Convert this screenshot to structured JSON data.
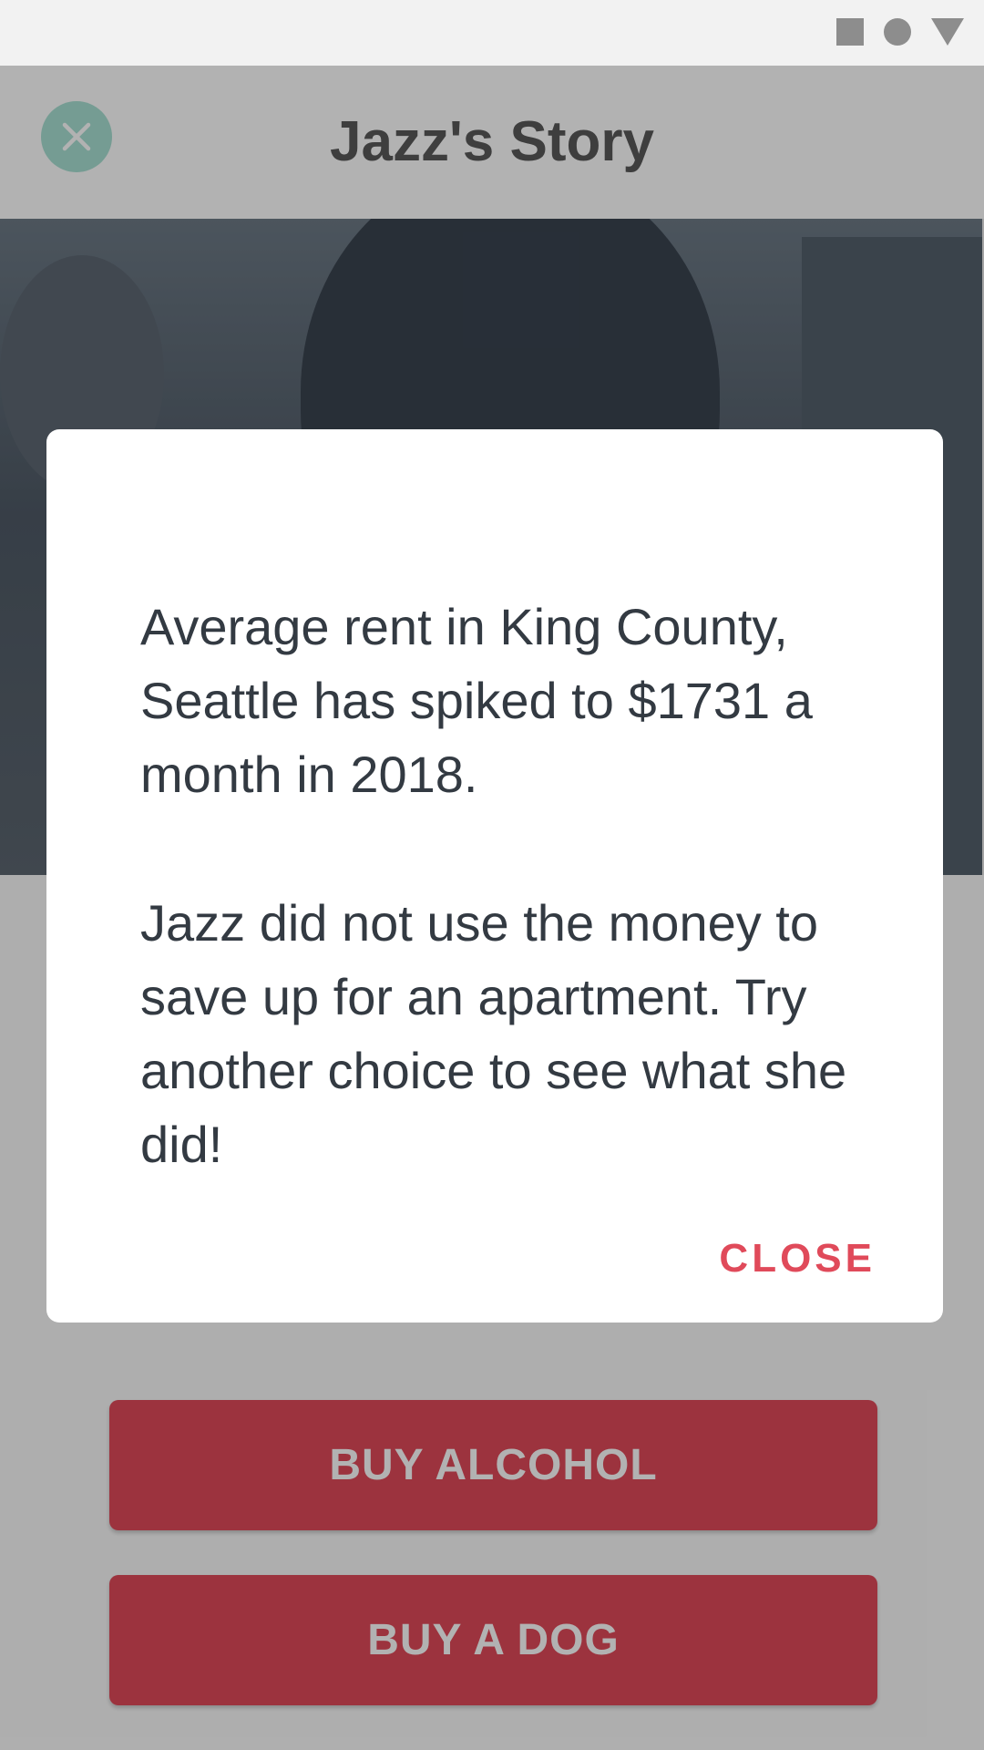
{
  "header": {
    "title": "Jazz's Story",
    "close_icon": "close-icon"
  },
  "status_bar": {
    "icons": [
      "square-icon",
      "circle-icon",
      "triangle-icon"
    ]
  },
  "choices": [
    {
      "label": "BUY ALCOHOL"
    },
    {
      "label": "BUY A DOG"
    }
  ],
  "dialog": {
    "paragraph_1": "Average rent in King County, Seattle has spiked to $1731 a month in 2018.",
    "paragraph_2": "Jazz did not use the money to save up for an apartment. Try another choice to see what she did!",
    "close_label": "CLOSE"
  },
  "colors": {
    "accent": "#e04a5a",
    "teal": "#a8e0d3",
    "text": "#333a42"
  }
}
